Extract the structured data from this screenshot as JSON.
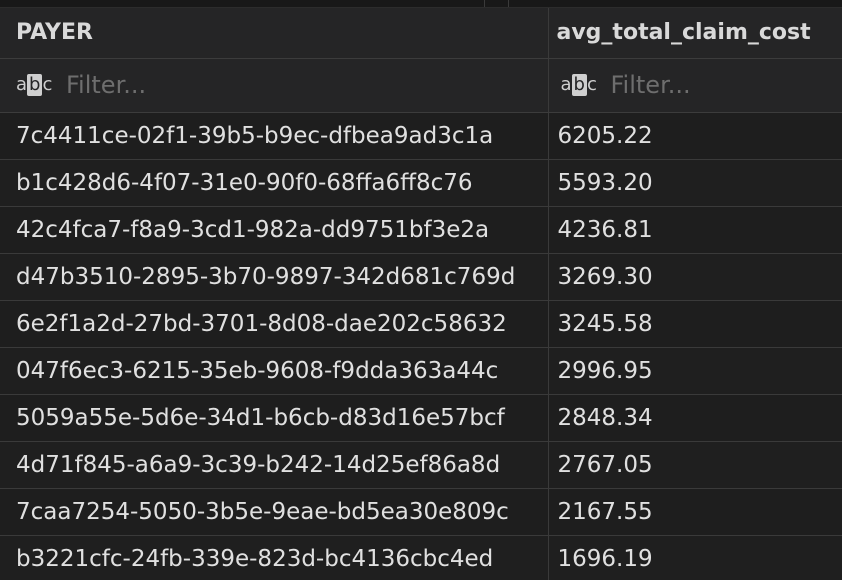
{
  "columns": [
    {
      "label": "PAYER"
    },
    {
      "label": "avg_total_claim_cost"
    }
  ],
  "filter": {
    "placeholder": "Filter...",
    "type_icon": "text-type-icon"
  },
  "rows": [
    {
      "payer": "7c4411ce-02f1-39b5-b9ec-dfbea9ad3c1a",
      "avg": "6205.22"
    },
    {
      "payer": "b1c428d6-4f07-31e0-90f0-68ffa6ff8c76",
      "avg": "5593.20"
    },
    {
      "payer": "42c4fca7-f8a9-3cd1-982a-dd9751bf3e2a",
      "avg": "4236.81"
    },
    {
      "payer": "d47b3510-2895-3b70-9897-342d681c769d",
      "avg": "3269.30"
    },
    {
      "payer": "6e2f1a2d-27bd-3701-8d08-dae202c58632",
      "avg": "3245.58"
    },
    {
      "payer": "047f6ec3-6215-35eb-9608-f9dda363a44c",
      "avg": "2996.95"
    },
    {
      "payer": "5059a55e-5d6e-34d1-b6cb-d83d16e57bcf",
      "avg": "2848.34"
    },
    {
      "payer": "4d71f845-a6a9-3c39-b242-14d25ef86a8d",
      "avg": "2767.05"
    },
    {
      "payer": "7caa7254-5050-3b5e-9eae-bd5ea30e809c",
      "avg": "2167.55"
    },
    {
      "payer": "b3221cfc-24fb-339e-823d-bc4136cbc4ed",
      "avg": "1696.19"
    }
  ]
}
